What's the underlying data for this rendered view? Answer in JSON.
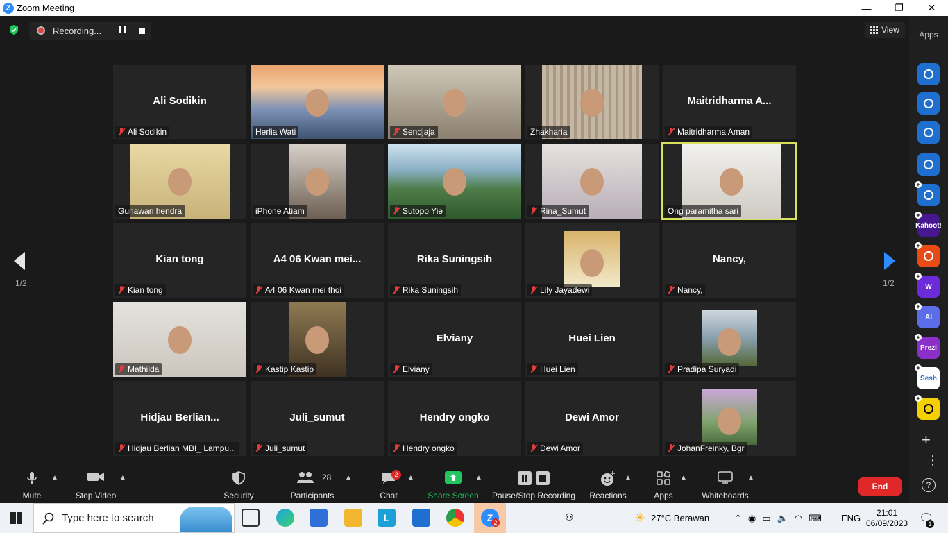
{
  "window": {
    "title": "Zoom Meeting",
    "controls": {
      "minimize": "—",
      "maximize": "❐",
      "close": "✕"
    }
  },
  "recording": {
    "label": "Recording..."
  },
  "view": {
    "label": "View"
  },
  "pagination": {
    "left": "1/2",
    "right": "1/2"
  },
  "participants": [
    {
      "name": "Ali Sodikin",
      "display": "Ali Sodikin",
      "muted": true,
      "video": false
    },
    {
      "name": "Herlia Wati",
      "display": "",
      "muted": false,
      "video": true
    },
    {
      "name": "Sendjaja",
      "display": "",
      "muted": true,
      "video": true
    },
    {
      "name": "Zhakharia",
      "display": "",
      "muted": false,
      "video": true
    },
    {
      "name": "Maitridharma Aman",
      "display": "Maitridharma  A...",
      "muted": true,
      "video": false
    },
    {
      "name": "Gunawan hendra",
      "display": "",
      "muted": false,
      "video": true
    },
    {
      "name": "iPhone Atiam",
      "display": "",
      "muted": false,
      "video": true
    },
    {
      "name": "Sutopo Yie",
      "display": "",
      "muted": true,
      "video": true
    },
    {
      "name": "Rina_Sumut",
      "display": "",
      "muted": true,
      "video": true
    },
    {
      "name": "Ong paramitha sari",
      "display": "",
      "muted": false,
      "video": true,
      "active": true
    },
    {
      "name": "Kian tong",
      "display": "Kian tong",
      "muted": true,
      "video": false
    },
    {
      "name": "A4 06 Kwan mei thoi",
      "display": "A4 06 Kwan mei...",
      "muted": true,
      "video": false
    },
    {
      "name": "Rika Suningsih",
      "display": "Rika Suningsih",
      "muted": true,
      "video": false
    },
    {
      "name": "Lily Jayadewi",
      "display": "",
      "muted": true,
      "video": true
    },
    {
      "name": "Nancy,",
      "display": "Nancy,",
      "muted": true,
      "video": false
    },
    {
      "name": "Mathilda",
      "display": "",
      "muted": true,
      "video": true
    },
    {
      "name": "Kastip Kastip",
      "display": "",
      "muted": true,
      "video": true
    },
    {
      "name": "Elviany",
      "display": "Elviany",
      "muted": true,
      "video": false
    },
    {
      "name": "Huei Lien",
      "display": "Huei Lien",
      "muted": true,
      "video": false
    },
    {
      "name": "Pradipa Suryadi",
      "display": "",
      "muted": true,
      "video": true
    },
    {
      "name": "Hidjau Berlian MBI_ Lampu...",
      "display": "Hidjau  Berlian...",
      "muted": true,
      "video": false
    },
    {
      "name": "Juli_sumut",
      "display": "Juli_sumut",
      "muted": true,
      "video": false
    },
    {
      "name": "Hendry ongko",
      "display": "Hendry ongko",
      "muted": true,
      "video": false
    },
    {
      "name": "Dewi Amor",
      "display": "Dewi Amor",
      "muted": true,
      "video": false
    },
    {
      "name": "JohanFreinky, Bgr",
      "display": "",
      "muted": true,
      "video": true
    }
  ],
  "toolbar": {
    "mute": "Mute",
    "stop_video": "Stop Video",
    "security": "Security",
    "participants": "Participants",
    "participants_count": "28",
    "chat": "Chat",
    "chat_badge": "2",
    "share_screen": "Share Screen",
    "recording": "Pause/Stop Recording",
    "reactions": "Reactions",
    "apps": "Apps",
    "whiteboards": "Whiteboards",
    "end": "End"
  },
  "apps_sidebar": {
    "label": "Apps",
    "items": [
      "camera-app",
      "music-app",
      "timer-app",
      "avatar-app",
      "arrow-app",
      "Kahoot!",
      "orange-app",
      "W",
      "AI",
      "Prezi",
      "Sesh",
      "smile-app"
    ]
  },
  "taskbar": {
    "search_placeholder": "Type here to search",
    "weather": "27°C  Berawan",
    "lang": "ENG",
    "time": "21:01",
    "date": "06/09/2023",
    "zoom_badge": "2",
    "notif_badge": "1"
  },
  "colors": {
    "accent": "#2d8cff",
    "end": "#e02828",
    "share": "#22c55e",
    "active_border": "#d7e25a"
  }
}
